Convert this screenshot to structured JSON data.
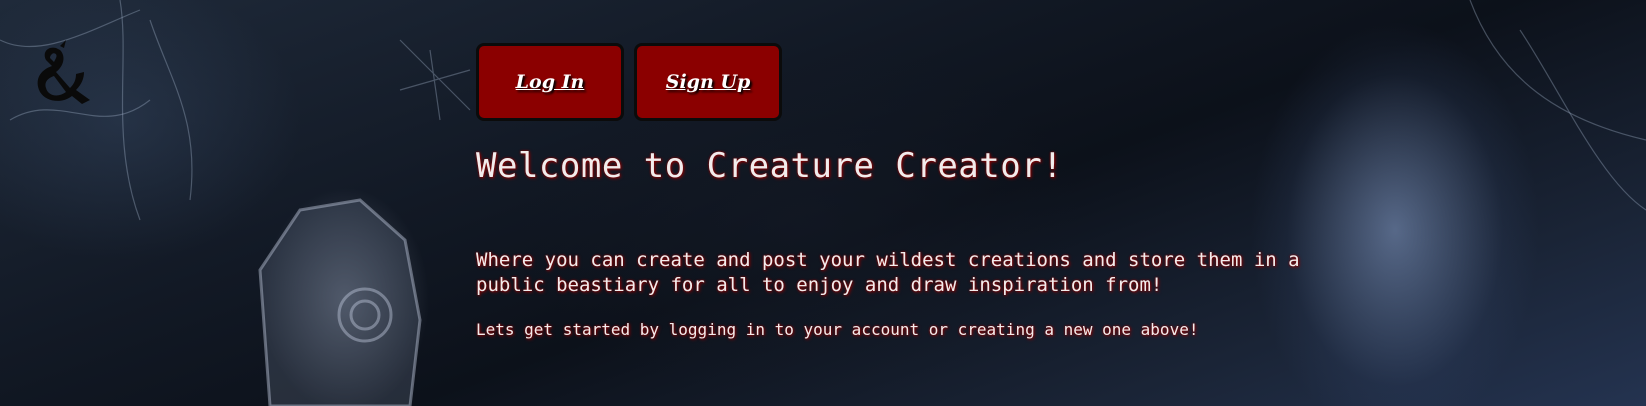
{
  "logo": {
    "icon": "ampersand-dragon-icon",
    "glyph": "&"
  },
  "nav": {
    "login_label": "Log In",
    "signup_label": "Sign Up"
  },
  "main": {
    "title": "Welcome to Creature Creator!",
    "lead": "Where you can create and post your wildest creations and store them in a public beastiary for all to enjoy and draw inspiration from!",
    "sub": "Lets get started by logging in to your account or creating a new one above!"
  },
  "colors": {
    "button_bg": "#8b0000",
    "text": "#f2ecec",
    "text_glow": "#8b0000"
  }
}
